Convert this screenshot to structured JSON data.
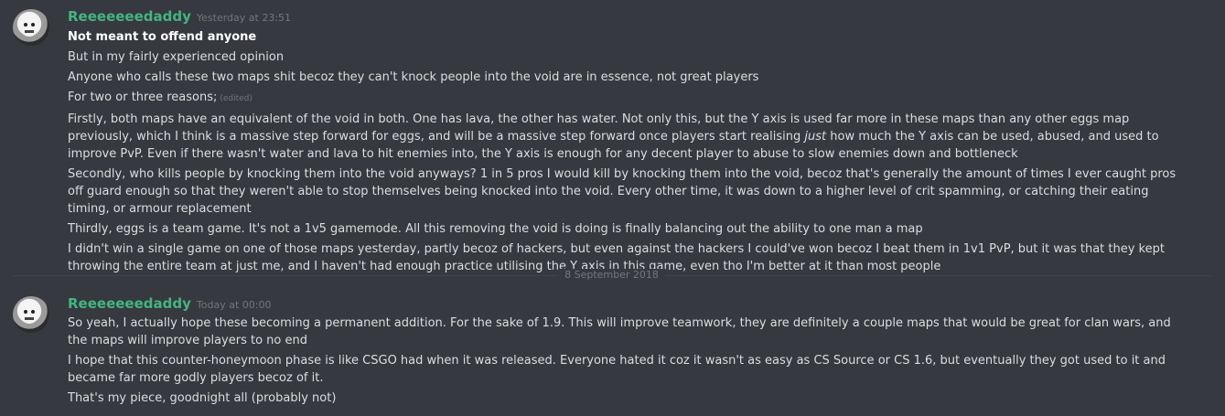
{
  "messages": [
    {
      "author": "Reeeeeeedaddy",
      "timestamp": "Yesterday at 23:51",
      "lines": [
        "Not meant to offend anyone",
        "But in my fairly experienced opinion",
        "Anyone who calls these two maps shit becoz they can't knock people into the void are in essence, not great players",
        "For two or three reasons;",
        "Firstly, both maps have an equivalent of the void in both. One has lava, the other has water. Not only this, but the Y axis is used far more in these maps than any other eggs map previously, which I think is a massive step forward for eggs, and will be a massive step forward once players start realising ",
        "just",
        " how much the Y axis can be used, abused, and used to improve PvP. Even if there wasn't water and lava to hit enemies into, the Y axis is enough for any decent player to abuse to slow enemies down and bottleneck",
        "Secondly, who kills people by knocking them into the void anyways? 1 in 5 pros I would kill by knocking them into the void, becoz that's generally the amount of times I ever caught pros off guard enough so that they weren't able to stop themselves being knocked into the void. Every other time, it was down to a higher level of crit spamming, or catching their eating timing, or armour replacement",
        "Thirdly, eggs is a team game. It's not a 1v5 gamemode. All this removing the void is doing is finally balancing out the ability to one man a map",
        "I didn't win a single game on one of those maps yesterday, partly becoz of hackers, but even against the hackers I could've won becoz I beat them in 1v1 PvP, but it was that they kept throwing the entire team at just me, and I haven't had enough practice utilising the Y axis in this game, even tho I'm better at it than most people"
      ],
      "edited_label": "(edited)"
    },
    {
      "author": "Reeeeeeedaddy",
      "timestamp": "Today at 00:00",
      "lines": [
        "So yeah, I actually hope these becoming a permanent addition. For the sake of 1.9. This will improve teamwork, they are definitely a couple maps that would be great for clan wars, and the maps will improve players to no end",
        "I hope that this counter-honeymoon phase is like CSGO had when it was released. Everyone hated it coz it wasn't as easy as CS Source or CS 1.6, but eventually they got used to it and became far more godly players becoz of it.",
        "That's my piece, goodnight all (probably not)"
      ]
    }
  ],
  "divider": {
    "date": "8 September 2018"
  },
  "colors": {
    "background": "#36393f",
    "username": "#43b581",
    "text": "#dcddde",
    "muted": "#72767d"
  },
  "icons": {
    "avatar": "ghost-avatar-icon"
  }
}
